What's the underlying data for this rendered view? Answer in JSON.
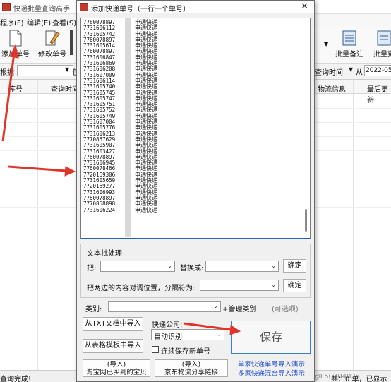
{
  "main_window": {
    "title": "快递批量查询高手",
    "menu": [
      "程序(F)",
      "编辑(E)",
      "查看(S)"
    ],
    "toolbar": {
      "add_label": "添加单号",
      "edit_label": "修改单号",
      "batch_note_label": "批量备注",
      "batch_more_label": "批量更"
    },
    "filter": {
      "left_label": "根据",
      "mid_label": "包",
      "query_time_label": "查询时间",
      "from_label": "从",
      "date_value": "2022-05-"
    },
    "grid_headers": {
      "seq": "序号",
      "query_time": "查询时间",
      "logistics": "物流信息",
      "latest": "最后更新"
    },
    "status_left": "查询完成!",
    "status_right": "共：0 单，已显示",
    "watermark": "CSDN @L50204023"
  },
  "dialog": {
    "title": "添加快递单号（一行一个单号）",
    "rows": [
      {
        "num": "7760078897",
        "co": "申通快递"
      },
      {
        "num": "7731606112",
        "co": "申通快递"
      },
      {
        "num": "7731605742",
        "co": "申通快递"
      },
      {
        "num": "7760078897",
        "co": "申通快递"
      },
      {
        "num": "7731605614",
        "co": "申通快递"
      },
      {
        "num": "7760078897",
        "co": "申通快递"
      },
      {
        "num": "7731606847",
        "co": "申通快递"
      },
      {
        "num": "7731606869",
        "co": "申通快递"
      },
      {
        "num": "7731606208",
        "co": "申通快递"
      },
      {
        "num": "7731607009",
        "co": "申通快递"
      },
      {
        "num": "7731606114",
        "co": "申通快递"
      },
      {
        "num": "7731605740",
        "co": "申通快递"
      },
      {
        "num": "7731605745",
        "co": "申通快递"
      },
      {
        "num": "7731605747",
        "co": "申通快递"
      },
      {
        "num": "7731605751",
        "co": "申通快递"
      },
      {
        "num": "7731605752",
        "co": "申通快递"
      },
      {
        "num": "7731605749",
        "co": "申通快递"
      },
      {
        "num": "7731607004",
        "co": "申通快递"
      },
      {
        "num": "7731605776",
        "co": "申通快递"
      },
      {
        "num": "7731606213",
        "co": "申通快递"
      },
      {
        "num": "7770857629",
        "co": "申通快递"
      },
      {
        "num": "7731605907",
        "co": "申通快递"
      },
      {
        "num": "7731603427",
        "co": "申通快递"
      },
      {
        "num": "7760078897",
        "co": "申通快递"
      },
      {
        "num": "7731606945",
        "co": "申通快递"
      },
      {
        "num": "7760078466",
        "co": "申通快递"
      },
      {
        "num": "7720169306",
        "co": "申通快递"
      },
      {
        "num": "7731605659",
        "co": "申通快递"
      },
      {
        "num": "7720169277",
        "co": "申通快递"
      },
      {
        "num": "7731606993",
        "co": "申通快递"
      },
      {
        "num": "7760078897",
        "co": "申通快递"
      },
      {
        "num": "7770858898",
        "co": "申通快递"
      },
      {
        "num": "7731606224",
        "co": "申通快递"
      }
    ],
    "text_batch": {
      "title": "文本批处理",
      "replace_from_label": "把:",
      "replace_to_label": "替换成:",
      "ok1": "确定",
      "swap_label": "把两边的内容对调位置，分隔符为:",
      "ok2": "确定"
    },
    "category_label": "类别:",
    "manage_category": "+管理类别",
    "optional": "(可选项)",
    "courier_label": "快递公司:",
    "courier_value": "自动识别",
    "import_txt": "从TXT文档中导入",
    "import_table": "从表格模板中导入",
    "continuous_save": "连续保存新单号",
    "import_taobao_1": "(导入)",
    "import_taobao_2": "淘宝网已买到的宝贝",
    "import_jd_1": "(导入)",
    "import_jd_2": "京东物流分享链接",
    "save": "保存",
    "link_single": "单家快递单号导入演示",
    "link_multi": "多家快递混合导入演示"
  }
}
